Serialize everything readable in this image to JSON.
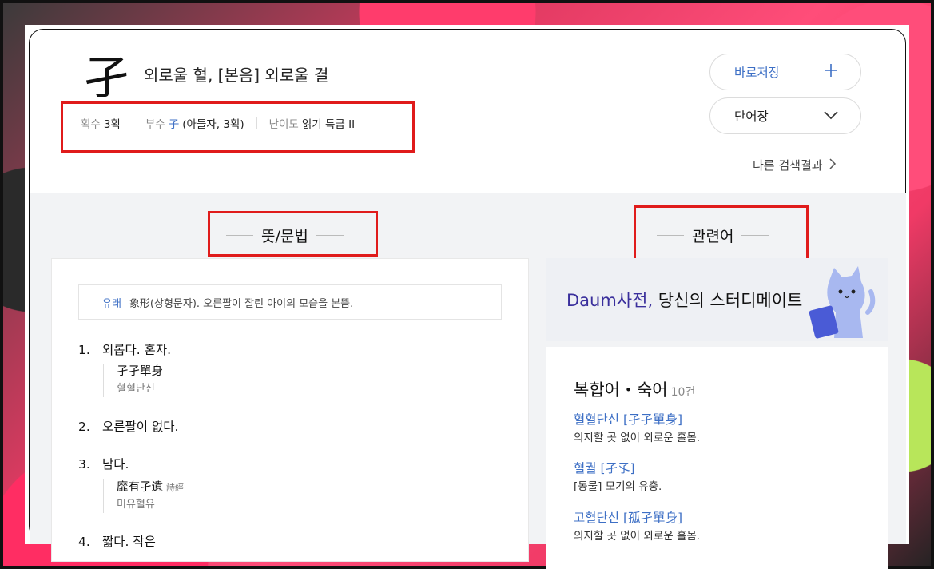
{
  "entry": {
    "hanja": "孑",
    "title": "외로울 혈, [본음] 외로울 결"
  },
  "meta": {
    "strokes_label": "획수",
    "strokes_value": "3획",
    "radical_label": "부수",
    "radical_char": "子",
    "radical_value": "(아들자, 3획)",
    "level_label": "난이도",
    "level_value": "읽기 특급 II"
  },
  "actions": {
    "save_label": "바로저장",
    "vocab_label": "단어장",
    "other_results": "다른 검색결과"
  },
  "sections": {
    "meaning": "뜻/문법",
    "related": "관련어"
  },
  "origin": {
    "label": "유래",
    "text": "象形(상형문자). 오른팔이 잘린 아이의 모습을 본뜸."
  },
  "definitions": [
    {
      "num": "1.",
      "text": "외롭다. 혼자.",
      "example_hanja": "孑孑單身",
      "example_source": "",
      "example_reading": "혈혈단신"
    },
    {
      "num": "2.",
      "text": "오른팔이 없다."
    },
    {
      "num": "3.",
      "text": "남다.",
      "example_hanja": "靡有孑遺",
      "example_source": "詩經",
      "example_reading": "미유혈유"
    },
    {
      "num": "4.",
      "text": "짧다. 작은"
    }
  ],
  "banner": {
    "brand": "Daum사전,",
    "text": " 당신의 스터디메이트"
  },
  "related": {
    "title": "복합어・숙어",
    "count": "10건",
    "items": [
      {
        "word": "혈혈단신 [孑孑單身]",
        "desc": "의지할 곳 없이 외로운 홀몸."
      },
      {
        "word": "혈궐 [孑孓]",
        "desc": "[동물] 모기의 유충."
      },
      {
        "word": "고혈단신 [孤孑單身]",
        "desc": "의지할 곳 없이 외로운 홀몸."
      }
    ]
  }
}
